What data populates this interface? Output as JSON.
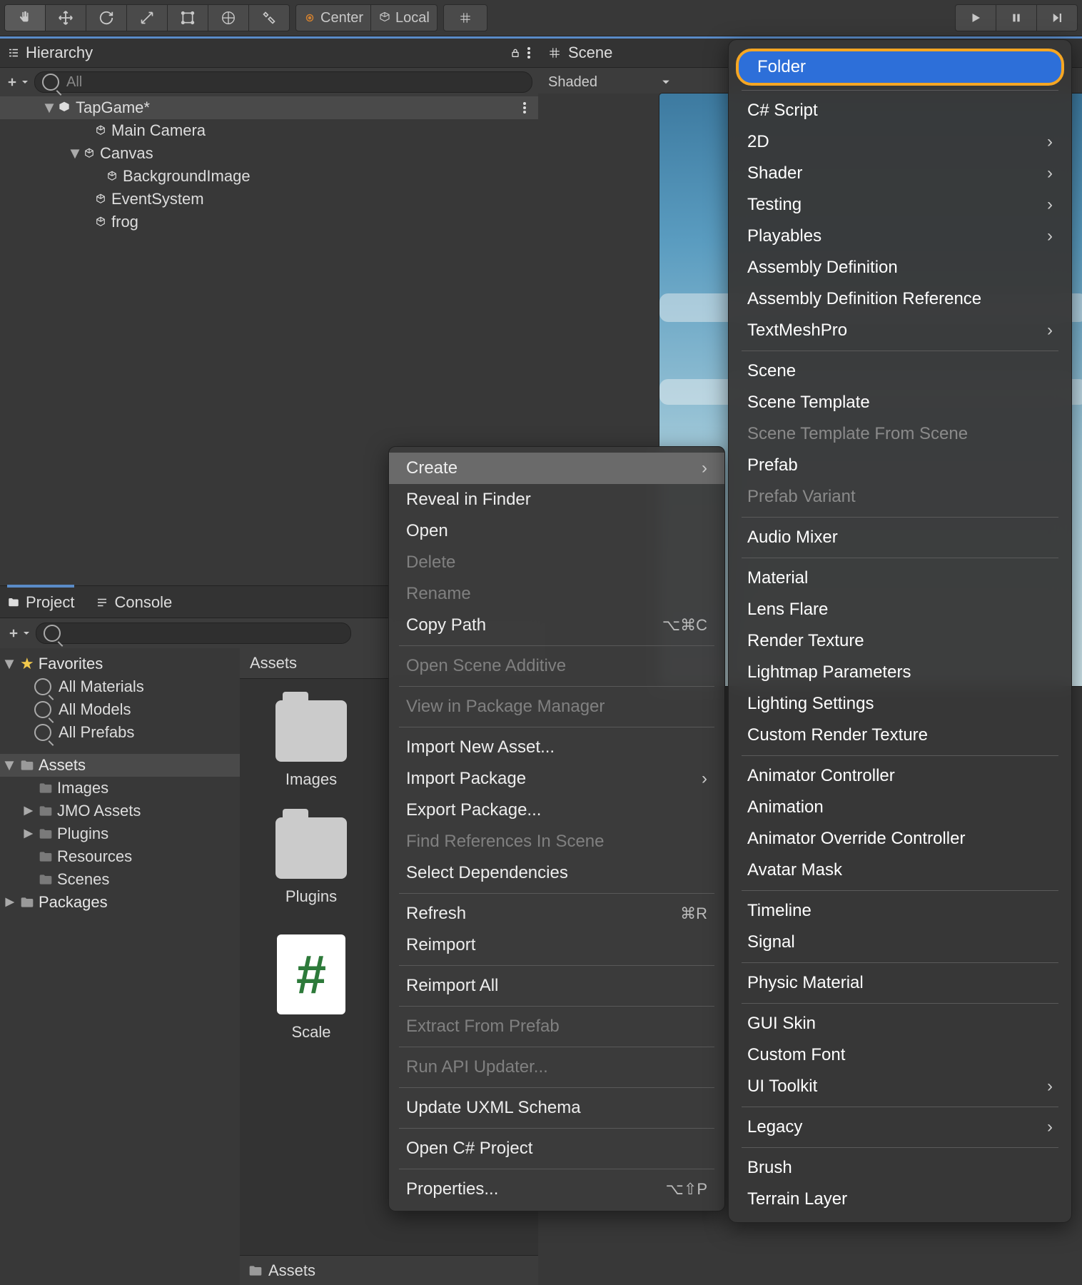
{
  "toolbar": {
    "center": "Center",
    "local": "Local"
  },
  "hierarchy": {
    "title": "Hierarchy",
    "search_placeholder": "All",
    "scene": "TapGame*",
    "items": [
      {
        "label": "Main Camera",
        "indent": 2
      },
      {
        "label": "Canvas",
        "indent": 1,
        "expandable": true
      },
      {
        "label": "BackgroundImage",
        "indent": 3
      },
      {
        "label": "EventSystem",
        "indent": 2
      },
      {
        "label": "frog",
        "indent": 2
      }
    ]
  },
  "scene": {
    "tab": "Scene",
    "mode": "Shaded"
  },
  "project": {
    "tab_project": "Project",
    "tab_console": "Console",
    "favorites": "Favorites",
    "fav_items": [
      "All Materials",
      "All Models",
      "All Prefabs"
    ],
    "assets_hdr": "Assets",
    "assets_children": [
      "Images",
      "JMO Assets",
      "Plugins",
      "Resources",
      "Scenes"
    ],
    "packages": "Packages",
    "grid_header": "Assets",
    "tiles": [
      {
        "label": "Images",
        "type": "folder"
      },
      {
        "label": "Plugins",
        "type": "folder"
      },
      {
        "label": "Scale",
        "type": "script"
      }
    ],
    "crumb": "Assets"
  },
  "context": {
    "items": [
      {
        "label": "Create",
        "sub": true,
        "hl": true
      },
      {
        "label": "Reveal in Finder"
      },
      {
        "label": "Open"
      },
      {
        "label": "Delete",
        "dis": true
      },
      {
        "label": "Rename",
        "dis": true
      },
      {
        "label": "Copy Path",
        "shortcut": "⌥⌘C"
      },
      {
        "sep": true
      },
      {
        "label": "Open Scene Additive",
        "dis": true
      },
      {
        "sep": true
      },
      {
        "label": "View in Package Manager",
        "dis": true
      },
      {
        "sep": true
      },
      {
        "label": "Import New Asset..."
      },
      {
        "label": "Import Package",
        "sub": true
      },
      {
        "label": "Export Package..."
      },
      {
        "label": "Find References In Scene",
        "dis": true
      },
      {
        "label": "Select Dependencies"
      },
      {
        "sep": true
      },
      {
        "label": "Refresh",
        "shortcut": "⌘R"
      },
      {
        "label": "Reimport"
      },
      {
        "sep": true
      },
      {
        "label": "Reimport All"
      },
      {
        "sep": true
      },
      {
        "label": "Extract From Prefab",
        "dis": true
      },
      {
        "sep": true
      },
      {
        "label": "Run API Updater...",
        "dis": true
      },
      {
        "sep": true
      },
      {
        "label": "Update UXML Schema"
      },
      {
        "sep": true
      },
      {
        "label": "Open C# Project"
      },
      {
        "sep": true
      },
      {
        "label": "Properties...",
        "shortcut": "⌥⇧P"
      }
    ]
  },
  "create_submenu": [
    {
      "label": "Folder",
      "hl": true
    },
    {
      "sep": true
    },
    {
      "label": "C# Script"
    },
    {
      "label": "2D",
      "sub": true
    },
    {
      "label": "Shader",
      "sub": true
    },
    {
      "label": "Testing",
      "sub": true
    },
    {
      "label": "Playables",
      "sub": true
    },
    {
      "label": "Assembly Definition"
    },
    {
      "label": "Assembly Definition Reference"
    },
    {
      "label": "TextMeshPro",
      "sub": true
    },
    {
      "sep": true
    },
    {
      "label": "Scene"
    },
    {
      "label": "Scene Template"
    },
    {
      "label": "Scene Template From Scene",
      "dis": true
    },
    {
      "label": "Prefab"
    },
    {
      "label": "Prefab Variant",
      "dis": true
    },
    {
      "sep": true
    },
    {
      "label": "Audio Mixer"
    },
    {
      "sep": true
    },
    {
      "label": "Material"
    },
    {
      "label": "Lens Flare"
    },
    {
      "label": "Render Texture"
    },
    {
      "label": "Lightmap Parameters"
    },
    {
      "label": "Lighting Settings"
    },
    {
      "label": "Custom Render Texture"
    },
    {
      "sep": true
    },
    {
      "label": "Animator Controller"
    },
    {
      "label": "Animation"
    },
    {
      "label": "Animator Override Controller"
    },
    {
      "label": "Avatar Mask"
    },
    {
      "sep": true
    },
    {
      "label": "Timeline"
    },
    {
      "label": "Signal"
    },
    {
      "sep": true
    },
    {
      "label": "Physic Material"
    },
    {
      "sep": true
    },
    {
      "label": "GUI Skin"
    },
    {
      "label": "Custom Font"
    },
    {
      "label": "UI Toolkit",
      "sub": true
    },
    {
      "sep": true
    },
    {
      "label": "Legacy",
      "sub": true
    },
    {
      "sep": true
    },
    {
      "label": "Brush"
    },
    {
      "label": "Terrain Layer"
    }
  ]
}
